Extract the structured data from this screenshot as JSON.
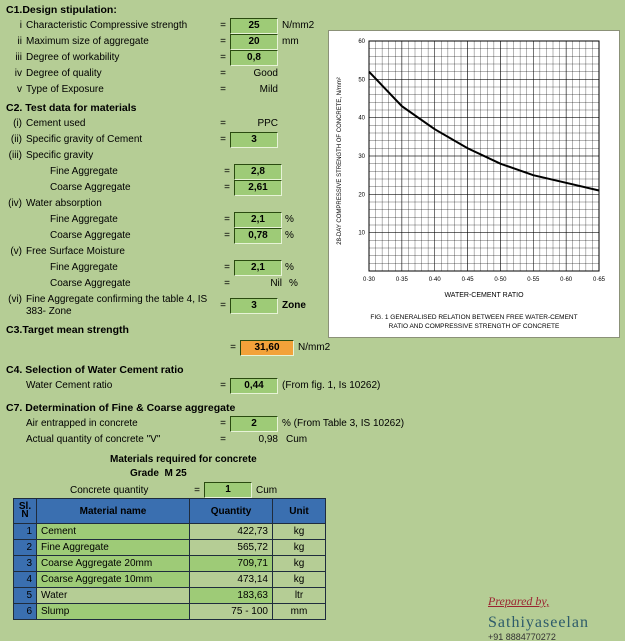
{
  "c1": {
    "title": "C1.Design stipulation:",
    "rows": [
      {
        "i": "i",
        "label": "Characteristic Compressive strength",
        "value": "25",
        "unit": "N/mm2",
        "box": true
      },
      {
        "i": "ii",
        "label": "Maximum size of aggregate",
        "value": "20",
        "unit": "mm",
        "box": true
      },
      {
        "i": "iii",
        "label": "Degree of workability",
        "value": "0,8",
        "unit": "",
        "box": true
      },
      {
        "i": "iv",
        "label": "Degree of quality",
        "value": "Good",
        "unit": "",
        "box": false
      },
      {
        "i": "v",
        "label": "Type of Exposure",
        "value": "Mild",
        "unit": "",
        "box": false
      }
    ]
  },
  "c2": {
    "title": "C2. Test data for materials",
    "cement_used": {
      "i": "(i)",
      "label": "Cement used",
      "value": "PPC"
    },
    "sg_cement": {
      "i": "(ii)",
      "label": "Specific gravity of Cement",
      "value": "3"
    },
    "sg_head": {
      "i": "(iii)",
      "label": "Specific gravity"
    },
    "sg_fine": {
      "label": "Fine Aggregate",
      "value": "2,8"
    },
    "sg_coarse": {
      "label": "Coarse Aggregate",
      "value": "2,61"
    },
    "wa_head": {
      "i": "(iv)",
      "label": "Water absorption"
    },
    "wa_fine": {
      "label": "Fine Aggregate",
      "value": "2,1",
      "pct": "%"
    },
    "wa_coarse": {
      "label": "Coarse Aggregate",
      "value": "0,78",
      "pct": "%"
    },
    "fsm_head": {
      "i": "(v)",
      "label": "Free Surface Moisture"
    },
    "fsm_fine": {
      "label": "Fine Aggregate",
      "value": "2,1",
      "pct": "%"
    },
    "fsm_coarse": {
      "label": "Coarse Aggregate",
      "value": "Nil",
      "pct": "%"
    },
    "zone": {
      "i": "(vi)",
      "label": "Fine Aggregate confirming the table 4, IS 383- Zone",
      "value": "3",
      "unit": "Zone"
    }
  },
  "c3": {
    "title": "C3.Target mean strength",
    "value": "31,60",
    "unit": "N/mm2"
  },
  "c4": {
    "title": "C4. Selection of Water Cement ratio",
    "label": "Water Cement ratio",
    "value": "0,44",
    "note": "(From fig. 1, Is 10262)"
  },
  "c7": {
    "title": "C7. Determination of Fine & Coarse aggregate",
    "air": {
      "label": "Air entrapped in concrete",
      "value": "2",
      "note": "% (From Table 3, IS 10262)"
    },
    "vol": {
      "label": "Actual quantity of concrete \"V\"",
      "value": "0,98",
      "unit": "Cum"
    },
    "subhead": "Materials required for concrete",
    "grade_lbl": "Grade",
    "grade_val": "M 25",
    "cq_label": "Concrete quantity",
    "cq_value": "1",
    "cq_unit": "Cum",
    "th_sn": "Sl. N",
    "th_name": "Material name",
    "th_qty": "Quantity",
    "th_unit": "Unit",
    "rows": [
      {
        "n": "1",
        "name": "Cement",
        "qty": "422,73",
        "unit": "kg",
        "h": false
      },
      {
        "n": "2",
        "name": "Fine Aggregate",
        "qty": "565,72",
        "unit": "kg",
        "h": false
      },
      {
        "n": "3",
        "name": "Coarse Aggregate 20mm",
        "qty": "709,71",
        "unit": "kg",
        "h": true
      },
      {
        "n": "4",
        "name": "Coarse Aggregate 10mm",
        "qty": "473,14",
        "unit": "kg",
        "h": false
      },
      {
        "n": "5",
        "name": "Water",
        "qty": "183,63",
        "unit": "ltr",
        "h": true,
        "w": true
      },
      {
        "n": "6",
        "name": "Slump",
        "qty": "75 - 100",
        "unit": "mm",
        "h": false
      }
    ]
  },
  "chart": {
    "ylabel": "28-DAY COMPRESSIVE STRENGTH OF CONCRETE, N/mm²",
    "xlabel": "WATER-CEMENT RATIO",
    "caption": "FIG. 1   GENERALISED RELATION BETWEEN FREE WATER-CEMENT RATIO AND COMPRESSIVE STRENGTH OF CONCRETE",
    "xticks": [
      "0·30",
      "0·35",
      "0·40",
      "0·45",
      "0·50",
      "0·55",
      "0·60",
      "0·65"
    ],
    "yticks": [
      "10",
      "20",
      "30",
      "40",
      "50",
      "60"
    ]
  },
  "chart_data": {
    "type": "line",
    "x": [
      0.3,
      0.35,
      0.4,
      0.45,
      0.5,
      0.55,
      0.6,
      0.65
    ],
    "y": [
      52,
      43,
      37,
      32,
      28,
      25,
      23,
      21
    ],
    "xlabel": "WATER-CEMENT RATIO",
    "ylabel": "28-DAY COMPRESSIVE STRENGTH OF CONCRETE, N/mm²",
    "xlim": [
      0.3,
      0.65
    ],
    "ylim": [
      0,
      60
    ],
    "title": "Fig. 1 Generalised Relation Between Free Water-Cement Ratio and Compressive Strength of Concrete"
  },
  "credits": {
    "prep": "Prepared by,",
    "author": "Sathiyaseelan",
    "phone": "+91 8884770272"
  }
}
